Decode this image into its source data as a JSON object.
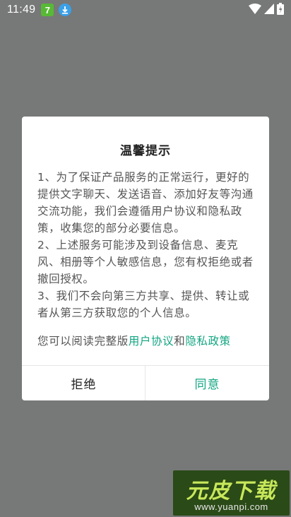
{
  "status_bar": {
    "time": "11:49",
    "app_icon_label": "7",
    "icons": [
      "app-7-icon",
      "download-icon",
      "wifi-icon",
      "signal-icon",
      "battery-icon"
    ]
  },
  "dialog": {
    "title": "温馨提示",
    "paragraphs": [
      "1、为了保证产品服务的正常运行，更好的提供文字聊天、发送语音、添加好友等沟通交流功能，我们会遵循用户协议和隐私政策，收集您的部分必要信息。",
      "2、上述服务可能涉及到设备信息、麦克风、相册等个人敏感信息，您有权拒绝或者撤回授权。",
      "3、我们不会向第三方共享、提供、转让或者从第三方获取您的个人信息。"
    ],
    "links_prefix": "您可以阅读完整版",
    "user_agreement_link": "用户协议",
    "links_and": "和",
    "privacy_policy_link": "隐私政策",
    "refuse_button": "拒绝",
    "agree_button": "同意"
  },
  "watermark": {
    "logo_text": "元皮下载",
    "url": "www.yuanpi.com"
  },
  "colors": {
    "accent": "#13a582",
    "overlay": "#777878",
    "dialog_bg": "#ffffff"
  }
}
